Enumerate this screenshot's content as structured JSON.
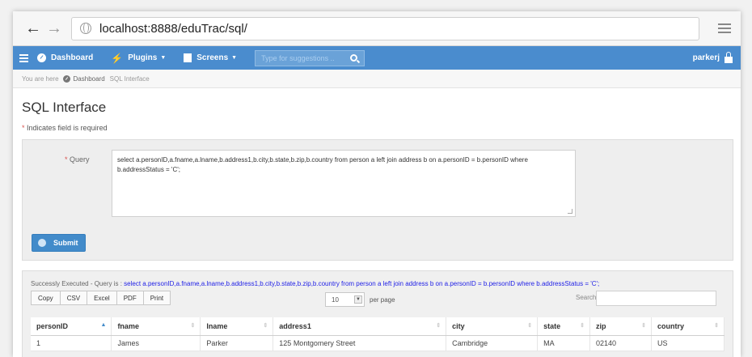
{
  "browser": {
    "url": "localhost:8888/eduTrac/sql/"
  },
  "nav": {
    "dashboard": "Dashboard",
    "plugins": "Plugins",
    "screens": "Screens",
    "search_placeholder": "Type for suggestions ..",
    "user": "parkerj"
  },
  "breadcrumb": {
    "prefix": "You are here",
    "home": "Dashboard",
    "current": "SQL Interface"
  },
  "page": {
    "title": "SQL Interface",
    "required_star": "*",
    "required_text": "Indicates field is required"
  },
  "query": {
    "label_star": "*",
    "label": "Query",
    "value": "select a.personID,a.fname,a.lname,b.address1,b.city,b.state,b.zip,b.country from person a left join address b on a.personID = b.personID where b.addressStatus = 'C';",
    "submit": "Submit"
  },
  "results": {
    "status_prefix": "Successly Executed - Query is :",
    "status_query": "select a.personID,a.fname,a.lname,b.address1,b.city,b.state,b.zip,b.country from person a left join address b on a.personID = b.personID where b.addressStatus = 'C';",
    "export_buttons": [
      "Copy",
      "CSV",
      "Excel",
      "PDF",
      "Print"
    ],
    "per_page_value": "10",
    "per_page_label": "per page",
    "search_label": "Search:",
    "columns": [
      "personID",
      "fname",
      "lname",
      "address1",
      "city",
      "state",
      "zip",
      "country"
    ],
    "rows": [
      [
        "1",
        "James",
        "Parker",
        "125 Montgomery Street",
        "Cambridge",
        "MA",
        "02140",
        "US"
      ]
    ]
  }
}
